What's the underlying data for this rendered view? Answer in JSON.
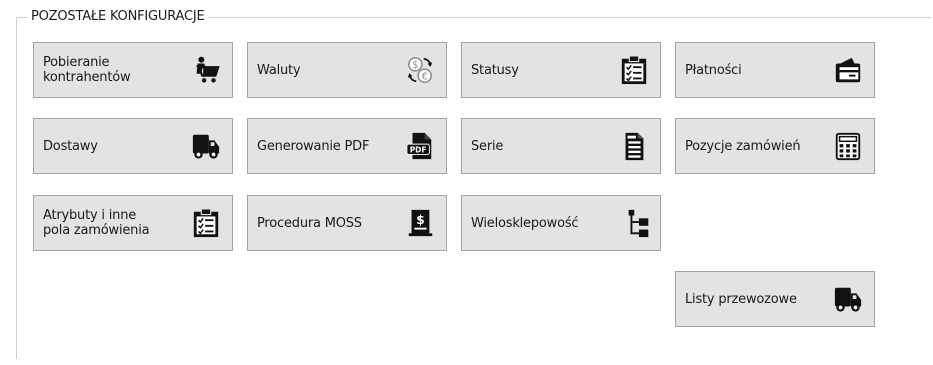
{
  "section": {
    "title": "POZOSTAŁE KONFIGURACJE"
  },
  "tiles": [
    {
      "label": "Pobieranie\nkontrahentów",
      "icon": "shopping-cart-person-icon"
    },
    {
      "label": "Waluty",
      "icon": "currency-exchange-icon"
    },
    {
      "label": "Statusy",
      "icon": "clipboard-checklist-icon"
    },
    {
      "label": "Płatności",
      "icon": "wallet-card-icon"
    },
    {
      "label": "Dostawy",
      "icon": "delivery-truck-icon"
    },
    {
      "label": "Generowanie PDF",
      "icon": "pdf-file-icon"
    },
    {
      "label": "Serie",
      "icon": "document-stack-icon"
    },
    {
      "label": "Pozycje zamówień",
      "icon": "calculator-icon"
    },
    {
      "label": "Atrybuty i inne\npola zamówienia",
      "icon": "clipboard-checklist-icon"
    },
    {
      "label": "Procedura MOSS",
      "icon": "dollar-document-icon"
    },
    {
      "label": "Wielosklepowość",
      "icon": "tree-hierarchy-icon"
    },
    {
      "label": "Listy przewozowe",
      "icon": "delivery-truck-icon"
    }
  ]
}
